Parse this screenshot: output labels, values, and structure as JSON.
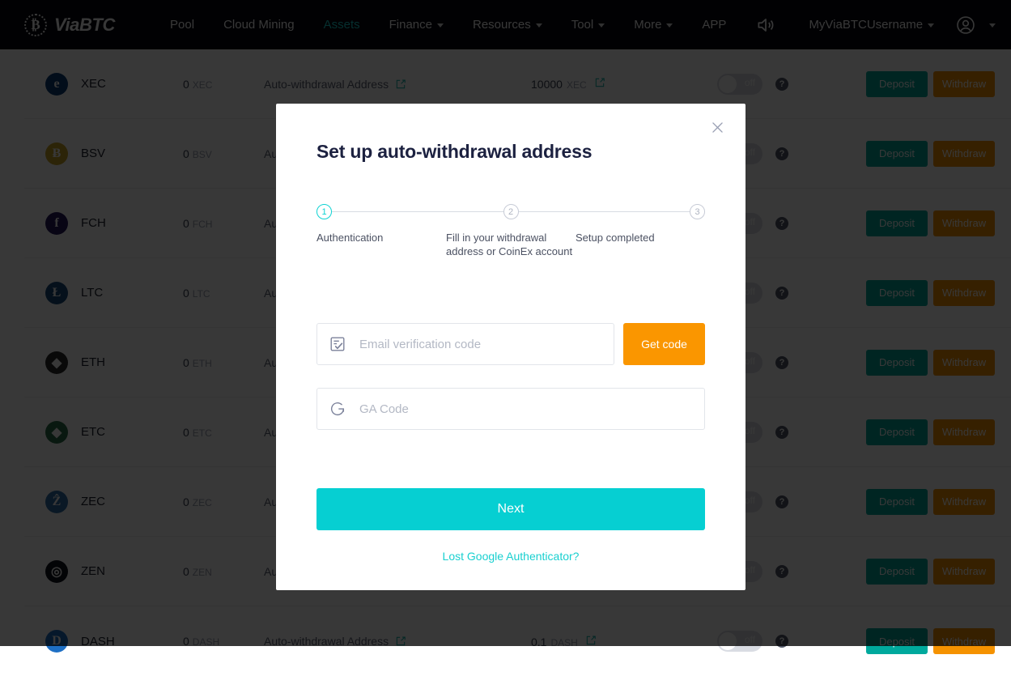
{
  "header": {
    "brand": {
      "mark": "bitcoin-icon",
      "text": "ViaBTC"
    },
    "menu_icon": "hamburger-icon",
    "nav": [
      {
        "label": "Pool",
        "has_caret": false,
        "active": false
      },
      {
        "label": "Cloud Mining",
        "has_caret": false,
        "active": false
      },
      {
        "label": "Assets",
        "has_caret": false,
        "active": true
      },
      {
        "label": "Finance",
        "has_caret": true,
        "active": false
      },
      {
        "label": "Resources",
        "has_caret": true,
        "active": false
      },
      {
        "label": "Tool",
        "has_caret": true,
        "active": false
      },
      {
        "label": "More",
        "has_caret": true,
        "active": false
      },
      {
        "label": "APP",
        "has_caret": false,
        "active": false
      }
    ],
    "sound_icon": "speaker-announcement-icon",
    "username": "MyViaBTCUsername",
    "account_icon": "user-avatar-icon",
    "language_flag": "uk-flag-icon",
    "accent_color": "#19d0d0",
    "bg_color": "#08080f"
  },
  "table": {
    "address_label": "Auto-withdrawal Address",
    "edit_icon": "edit-pencil-icon",
    "toggle_state": "off",
    "help_icon": "question-mark-icon",
    "deposit_label": "Deposit",
    "withdraw_label": "Withdraw",
    "deposit_color": "#00a99d",
    "withdraw_color": "#f59200",
    "rows": [
      {
        "coin": "XEC",
        "symbol": "e",
        "badge_color": "#0b3d77",
        "balance": "0",
        "unit": "XEC",
        "threshold": "10000",
        "threshold_unit": "XEC"
      },
      {
        "coin": "BSV",
        "symbol": "Ƀ",
        "badge_color": "#c9a227",
        "balance": "0",
        "unit": "BSV",
        "threshold": "",
        "threshold_unit": ""
      },
      {
        "coin": "FCH",
        "symbol": "f",
        "badge_color": "#251a5c",
        "balance": "0",
        "unit": "FCH",
        "threshold": "",
        "threshold_unit": ""
      },
      {
        "coin": "LTC",
        "symbol": "Ł",
        "badge_color": "#184a7a",
        "badge_text_color": "#ffffff",
        "balance": "0",
        "unit": "LTC",
        "threshold": "",
        "threshold_unit": ""
      },
      {
        "coin": "ETH",
        "symbol": "◆",
        "badge_color": "#2b2b2b",
        "balance": "0",
        "unit": "ETH",
        "threshold": "",
        "threshold_unit": ""
      },
      {
        "coin": "ETC",
        "symbol": "◆",
        "badge_color": "#2c6e49",
        "balance": "0",
        "unit": "ETC",
        "threshold": "",
        "threshold_unit": ""
      },
      {
        "coin": "ZEC",
        "symbol": "Ẑ",
        "badge_color": "#2f6fa8",
        "balance": "0",
        "unit": "ZEC",
        "threshold": "",
        "threshold_unit": ""
      },
      {
        "coin": "ZEN",
        "symbol": "◎",
        "badge_color": "#11131f",
        "balance": "0",
        "unit": "ZEN",
        "threshold": "",
        "threshold_unit": ""
      },
      {
        "coin": "DASH",
        "symbol": "D",
        "badge_color": "#1e6fc4",
        "balance": "0",
        "unit": "DASH",
        "threshold": "0.1",
        "threshold_unit": "DASH"
      }
    ]
  },
  "modal": {
    "title": "Set up auto-withdrawal address",
    "close_icon": "close-icon",
    "steps": [
      {
        "number": "1",
        "label": "Authentication",
        "active": true
      },
      {
        "number": "2",
        "label": "Fill in your withdrawal address or CoinEx account",
        "active": false
      },
      {
        "number": "3",
        "label": "Setup completed",
        "active": false
      }
    ],
    "email_field": {
      "icon": "email-verification-icon",
      "placeholder": "Email verification code",
      "value": ""
    },
    "get_code_label": "Get code",
    "get_code_color": "#fa9600",
    "ga_field": {
      "icon": "google-authenticator-icon",
      "placeholder": "GA Code",
      "value": ""
    },
    "next_label": "Next",
    "next_color": "#06cfd2",
    "lost_link": "Lost Google Authenticator?"
  }
}
